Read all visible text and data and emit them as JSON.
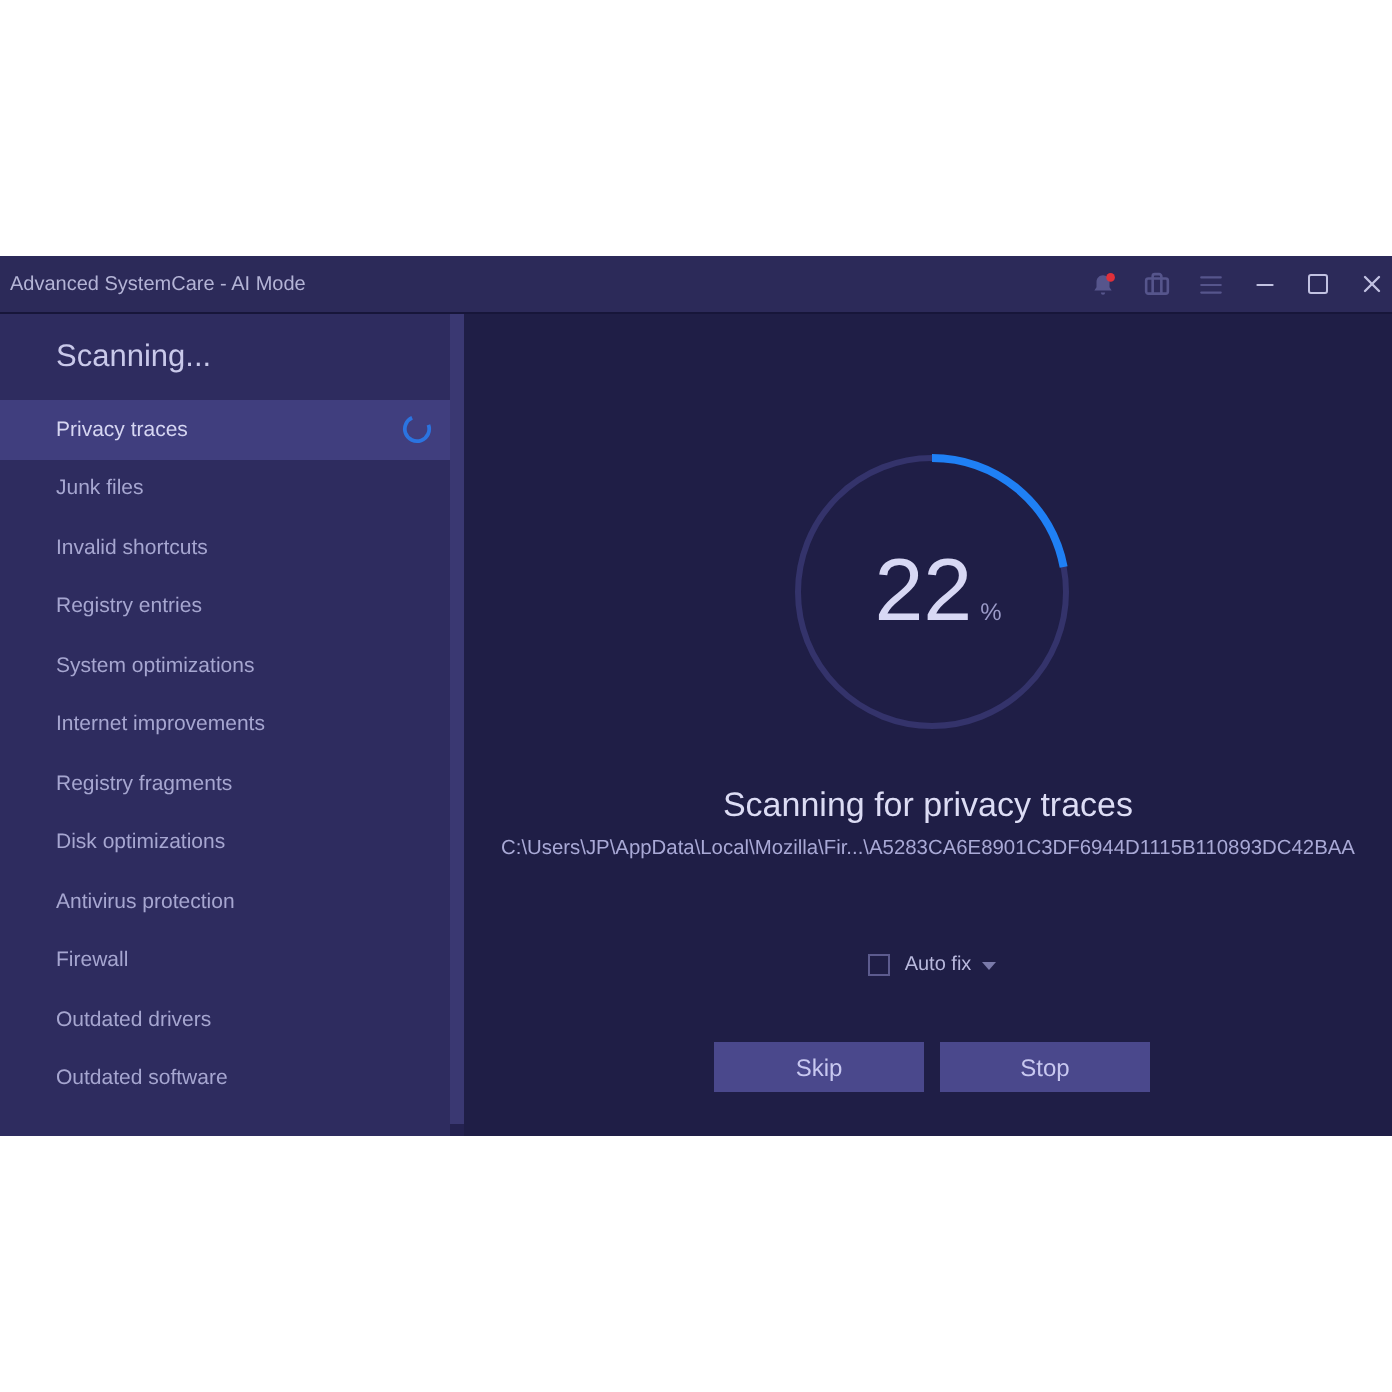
{
  "window": {
    "title": "Advanced SystemCare - AI Mode",
    "notification": true
  },
  "sidebar": {
    "heading": "Scanning...",
    "items": [
      {
        "label": "Privacy traces",
        "selected": true,
        "scanning": true
      },
      {
        "label": "Junk files",
        "selected": false,
        "scanning": false
      },
      {
        "label": "Invalid shortcuts",
        "selected": false,
        "scanning": false
      },
      {
        "label": "Registry entries",
        "selected": false,
        "scanning": false
      },
      {
        "label": "System optimizations",
        "selected": false,
        "scanning": false
      },
      {
        "label": "Internet improvements",
        "selected": false,
        "scanning": false
      },
      {
        "label": "Registry fragments",
        "selected": false,
        "scanning": false
      },
      {
        "label": "Disk optimizations",
        "selected": false,
        "scanning": false
      },
      {
        "label": "Antivirus protection",
        "selected": false,
        "scanning": false
      },
      {
        "label": "Firewall",
        "selected": false,
        "scanning": false
      },
      {
        "label": "Outdated drivers",
        "selected": false,
        "scanning": false
      },
      {
        "label": "Outdated software",
        "selected": false,
        "scanning": false
      }
    ]
  },
  "scan": {
    "progress": {
      "level": 0.22,
      "value": "22",
      "unit": "%"
    },
    "title": "Scanning for privacy traces",
    "path": "C:\\Users\\JP\\AppData\\Local\\Mozilla\\Fir...\\A5283CA6E8901C3DF6944D1115B110893DC42BAA",
    "auto_fix": {
      "label": "Auto fix",
      "checked": false
    },
    "buttons": [
      {
        "label": "Skip"
      },
      {
        "label": "Stop"
      }
    ]
  }
}
